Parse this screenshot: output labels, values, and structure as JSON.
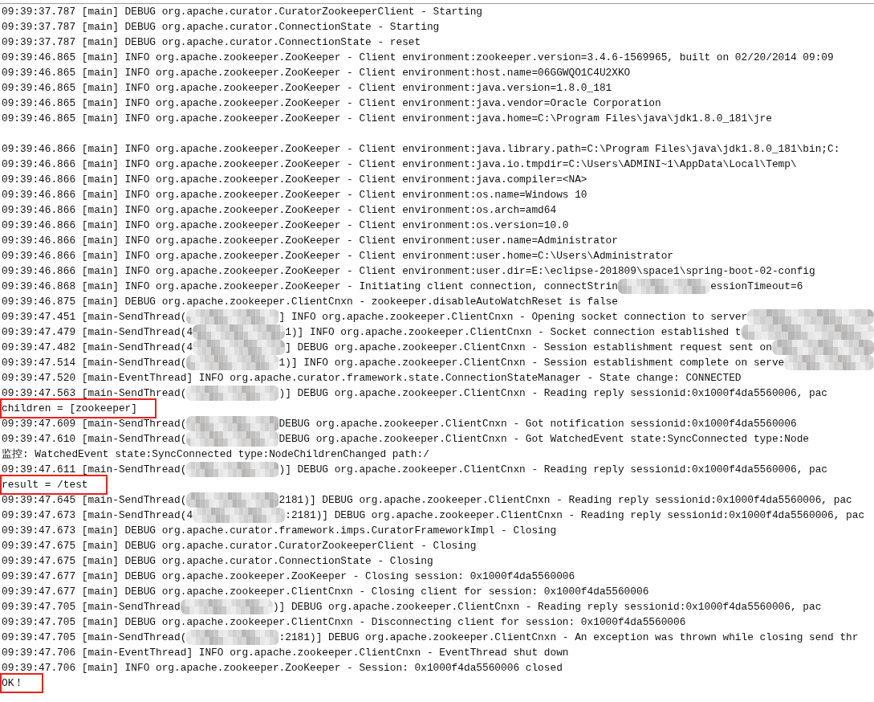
{
  "console": {
    "lines": [
      {
        "kind": "log",
        "parts": [
          {
            "kind": "text",
            "text": "09:39:37.787 [main] DEBUG org.apache.curator.CuratorZookeeperClient - Starting"
          }
        ]
      },
      {
        "kind": "log",
        "parts": [
          {
            "kind": "text",
            "text": "09:39:37.787 [main] DEBUG org.apache.curator.ConnectionState - Starting"
          }
        ]
      },
      {
        "kind": "log",
        "parts": [
          {
            "kind": "text",
            "text": "09:39:37.787 [main] DEBUG org.apache.curator.ConnectionState - reset"
          }
        ]
      },
      {
        "kind": "log",
        "parts": [
          {
            "kind": "text",
            "text": "09:39:46.865 [main] INFO org.apache.zookeeper.ZooKeeper - Client environment:zookeeper.version=3.4.6-1569965, built on 02/20/2014 09:09"
          }
        ]
      },
      {
        "kind": "log",
        "parts": [
          {
            "kind": "text",
            "text": "09:39:46.865 [main] INFO org.apache.zookeeper.ZooKeeper - Client environment:host.name=06GGWQO1C4U2XKO"
          }
        ]
      },
      {
        "kind": "log",
        "parts": [
          {
            "kind": "text",
            "text": "09:39:46.865 [main] INFO org.apache.zookeeper.ZooKeeper - Client environment:java.version=1.8.0_181"
          }
        ]
      },
      {
        "kind": "log",
        "parts": [
          {
            "kind": "text",
            "text": "09:39:46.865 [main] INFO org.apache.zookeeper.ZooKeeper - Client environment:java.vendor=Oracle Corporation"
          }
        ]
      },
      {
        "kind": "log",
        "parts": [
          {
            "kind": "text",
            "text": "09:39:46.865 [main] INFO org.apache.zookeeper.ZooKeeper - Client environment:java.home=C:\\Program Files\\java\\jdk1.8.0_181\\jre"
          }
        ]
      },
      {
        "kind": "blank"
      },
      {
        "kind": "log",
        "parts": [
          {
            "kind": "text",
            "text": "09:39:46.866 [main] INFO org.apache.zookeeper.ZooKeeper - Client environment:java.library.path=C:\\Program Files\\java\\jdk1.8.0_181\\bin;C:"
          }
        ]
      },
      {
        "kind": "log",
        "parts": [
          {
            "kind": "text",
            "text": "09:39:46.866 [main] INFO org.apache.zookeeper.ZooKeeper - Client environment:java.io.tmpdir=C:\\Users\\ADMINI~1\\AppData\\Local\\Temp\\"
          }
        ]
      },
      {
        "kind": "log",
        "parts": [
          {
            "kind": "text",
            "text": "09:39:46.866 [main] INFO org.apache.zookeeper.ZooKeeper - Client environment:java.compiler=<NA>"
          }
        ]
      },
      {
        "kind": "log",
        "parts": [
          {
            "kind": "text",
            "text": "09:39:46.866 [main] INFO org.apache.zookeeper.ZooKeeper - Client environment:os.name=Windows 10"
          }
        ]
      },
      {
        "kind": "log",
        "parts": [
          {
            "kind": "text",
            "text": "09:39:46.866 [main] INFO org.apache.zookeeper.ZooKeeper - Client environment:os.arch=amd64"
          }
        ]
      },
      {
        "kind": "log",
        "parts": [
          {
            "kind": "text",
            "text": "09:39:46.866 [main] INFO org.apache.zookeeper.ZooKeeper - Client environment:os.version=10.0"
          }
        ]
      },
      {
        "kind": "log",
        "parts": [
          {
            "kind": "text",
            "text": "09:39:46.866 [main] INFO org.apache.zookeeper.ZooKeeper - Client environment:user.name=Administrator"
          }
        ]
      },
      {
        "kind": "log",
        "parts": [
          {
            "kind": "text",
            "text": "09:39:46.866 [main] INFO org.apache.zookeeper.ZooKeeper - Client environment:user.home=C:\\Users\\Administrator"
          }
        ]
      },
      {
        "kind": "log",
        "parts": [
          {
            "kind": "text",
            "text": "09:39:46.866 [main] INFO org.apache.zookeeper.ZooKeeper - Client environment:user.dir=E:\\eclipse-201809\\space1\\spring-boot-02-config"
          }
        ]
      },
      {
        "kind": "log",
        "parts": [
          {
            "kind": "text",
            "text": "09:39:46.868 [main] INFO org.apache.zookeeper.ZooKeeper - Initiating client connection, connectStrin"
          },
          {
            "kind": "redaction"
          },
          {
            "kind": "text",
            "text": "essionTimeout=6"
          }
        ]
      },
      {
        "kind": "log",
        "parts": [
          {
            "kind": "text",
            "text": "09:39:46.875 [main] DEBUG org.apache.zookeeper.ClientCnxn - zookeeper.disableAutoWatchReset is false"
          }
        ]
      },
      {
        "kind": "log",
        "parts": [
          {
            "kind": "text",
            "text": "09:39:47.451 [main-SendThread("
          },
          {
            "kind": "redaction"
          },
          {
            "kind": "text",
            "text": "] INFO org.apache.zookeeper.ClientCnxn - Opening socket connection to server"
          },
          {
            "kind": "redaction"
          }
        ]
      },
      {
        "kind": "log",
        "parts": [
          {
            "kind": "text",
            "text": "09:39:47.479 [main-SendThread(4"
          },
          {
            "kind": "redaction"
          },
          {
            "kind": "text",
            "text": "1)] INFO org.apache.zookeeper.ClientCnxn - Socket connection established t"
          },
          {
            "kind": "redaction"
          }
        ]
      },
      {
        "kind": "log",
        "parts": [
          {
            "kind": "text",
            "text": "09:39:47.482 [main-SendThread(4"
          },
          {
            "kind": "redaction"
          },
          {
            "kind": "text",
            "text": "] DEBUG org.apache.zookeeper.ClientCnxn - Session establishment request sent on"
          },
          {
            "kind": "redaction"
          }
        ]
      },
      {
        "kind": "log",
        "parts": [
          {
            "kind": "text",
            "text": "09:39:47.514 [main-SendThread("
          },
          {
            "kind": "redaction"
          },
          {
            "kind": "text",
            "text": "1)] INFO org.apache.zookeeper.ClientCnxn - Session establishment complete on serve"
          },
          {
            "kind": "redaction"
          }
        ]
      },
      {
        "kind": "log",
        "parts": [
          {
            "kind": "text",
            "text": "09:39:47.520 [main-EventThread] INFO org.apache.curator.framework.state.ConnectionStateManager - State change: CONNECTED"
          }
        ]
      },
      {
        "kind": "log",
        "parts": [
          {
            "kind": "text",
            "text": "09:39:47.563 [main-SendThread("
          },
          {
            "kind": "redaction"
          },
          {
            "kind": "text",
            "text": ")] DEBUG org.apache.zookeeper.ClientCnxn - Reading reply sessionid:0x1000f4da5560006, pac"
          }
        ]
      },
      {
        "kind": "output",
        "text": "children = [zookeeper]",
        "highlighted": true
      },
      {
        "kind": "log",
        "parts": [
          {
            "kind": "text",
            "text": "09:39:47.609 [main-SendThread("
          },
          {
            "kind": "redaction"
          },
          {
            "kind": "text",
            "text": "DEBUG org.apache.zookeeper.ClientCnxn - Got notification sessionid:0x1000f4da5560006"
          }
        ]
      },
      {
        "kind": "log",
        "parts": [
          {
            "kind": "text",
            "text": "09:39:47.610 [main-SendThread("
          },
          {
            "kind": "redaction"
          },
          {
            "kind": "text",
            "text": "DEBUG org.apache.zookeeper.ClientCnxn - Got WatchedEvent state:SyncConnected type:Node"
          }
        ]
      },
      {
        "kind": "output",
        "text": "监控: WatchedEvent state:SyncConnected type:NodeChildrenChanged path:/",
        "highlighted": false
      },
      {
        "kind": "log",
        "parts": [
          {
            "kind": "text",
            "text": "09:39:47.611 [main-SendThread("
          },
          {
            "kind": "redaction"
          },
          {
            "kind": "text",
            "text": ")] DEBUG org.apache.zookeeper.ClientCnxn - Reading reply sessionid:0x1000f4da5560006, pac"
          }
        ]
      },
      {
        "kind": "output",
        "text": "result = /test",
        "highlighted": true
      },
      {
        "kind": "log",
        "parts": [
          {
            "kind": "text",
            "text": "09:39:47.645 [main-SendThread("
          },
          {
            "kind": "redaction"
          },
          {
            "kind": "text",
            "text": "2181)] DEBUG org.apache.zookeeper.ClientCnxn - Reading reply sessionid:0x1000f4da5560006, pac"
          }
        ]
      },
      {
        "kind": "log",
        "parts": [
          {
            "kind": "text",
            "text": "09:39:47.673 [main-SendThread(4"
          },
          {
            "kind": "redaction"
          },
          {
            "kind": "text",
            "text": ":2181)] DEBUG org.apache.zookeeper.ClientCnxn - Reading reply sessionid:0x1000f4da5560006, pac"
          }
        ]
      },
      {
        "kind": "log",
        "parts": [
          {
            "kind": "text",
            "text": "09:39:47.673 [main] DEBUG org.apache.curator.framework.imps.CuratorFrameworkImpl - Closing"
          }
        ]
      },
      {
        "kind": "log",
        "parts": [
          {
            "kind": "text",
            "text": "09:39:47.675 [main] DEBUG org.apache.curator.CuratorZookeeperClient - Closing"
          }
        ]
      },
      {
        "kind": "log",
        "parts": [
          {
            "kind": "text",
            "text": "09:39:47.675 [main] DEBUG org.apache.curator.ConnectionState - Closing"
          }
        ]
      },
      {
        "kind": "log",
        "parts": [
          {
            "kind": "text",
            "text": "09:39:47.677 [main] DEBUG org.apache.zookeeper.ZooKeeper - Closing session: 0x1000f4da5560006"
          }
        ]
      },
      {
        "kind": "log",
        "parts": [
          {
            "kind": "text",
            "text": "09:39:47.677 [main] DEBUG org.apache.zookeeper.ClientCnxn - Closing client for session: 0x1000f4da5560006"
          }
        ]
      },
      {
        "kind": "log",
        "parts": [
          {
            "kind": "text",
            "text": "09:39:47.705 [main-SendThread"
          },
          {
            "kind": "redaction"
          },
          {
            "kind": "text",
            "text": ")] DEBUG org.apache.zookeeper.ClientCnxn - Reading reply sessionid:0x1000f4da5560006, pac"
          }
        ]
      },
      {
        "kind": "log",
        "parts": [
          {
            "kind": "text",
            "text": "09:39:47.705 [main] DEBUG org.apache.zookeeper.ClientCnxn - Disconnecting client for session: 0x1000f4da5560006"
          }
        ]
      },
      {
        "kind": "log",
        "parts": [
          {
            "kind": "text",
            "text": "09:39:47.705 [main-SendThread("
          },
          {
            "kind": "redaction"
          },
          {
            "kind": "text",
            "text": ":2181)] DEBUG org.apache.zookeeper.ClientCnxn - An exception was thrown while closing send thr"
          }
        ]
      },
      {
        "kind": "log",
        "parts": [
          {
            "kind": "text",
            "text": "09:39:47.706 [main-EventThread] INFO org.apache.zookeeper.ClientCnxn - EventThread shut down"
          }
        ]
      },
      {
        "kind": "log",
        "parts": [
          {
            "kind": "text",
            "text": "09:39:47.706 [main] INFO org.apache.zookeeper.ZooKeeper - Session: 0x1000f4da5560006 closed"
          }
        ]
      },
      {
        "kind": "output",
        "text": "OK！",
        "highlighted": true
      }
    ]
  }
}
